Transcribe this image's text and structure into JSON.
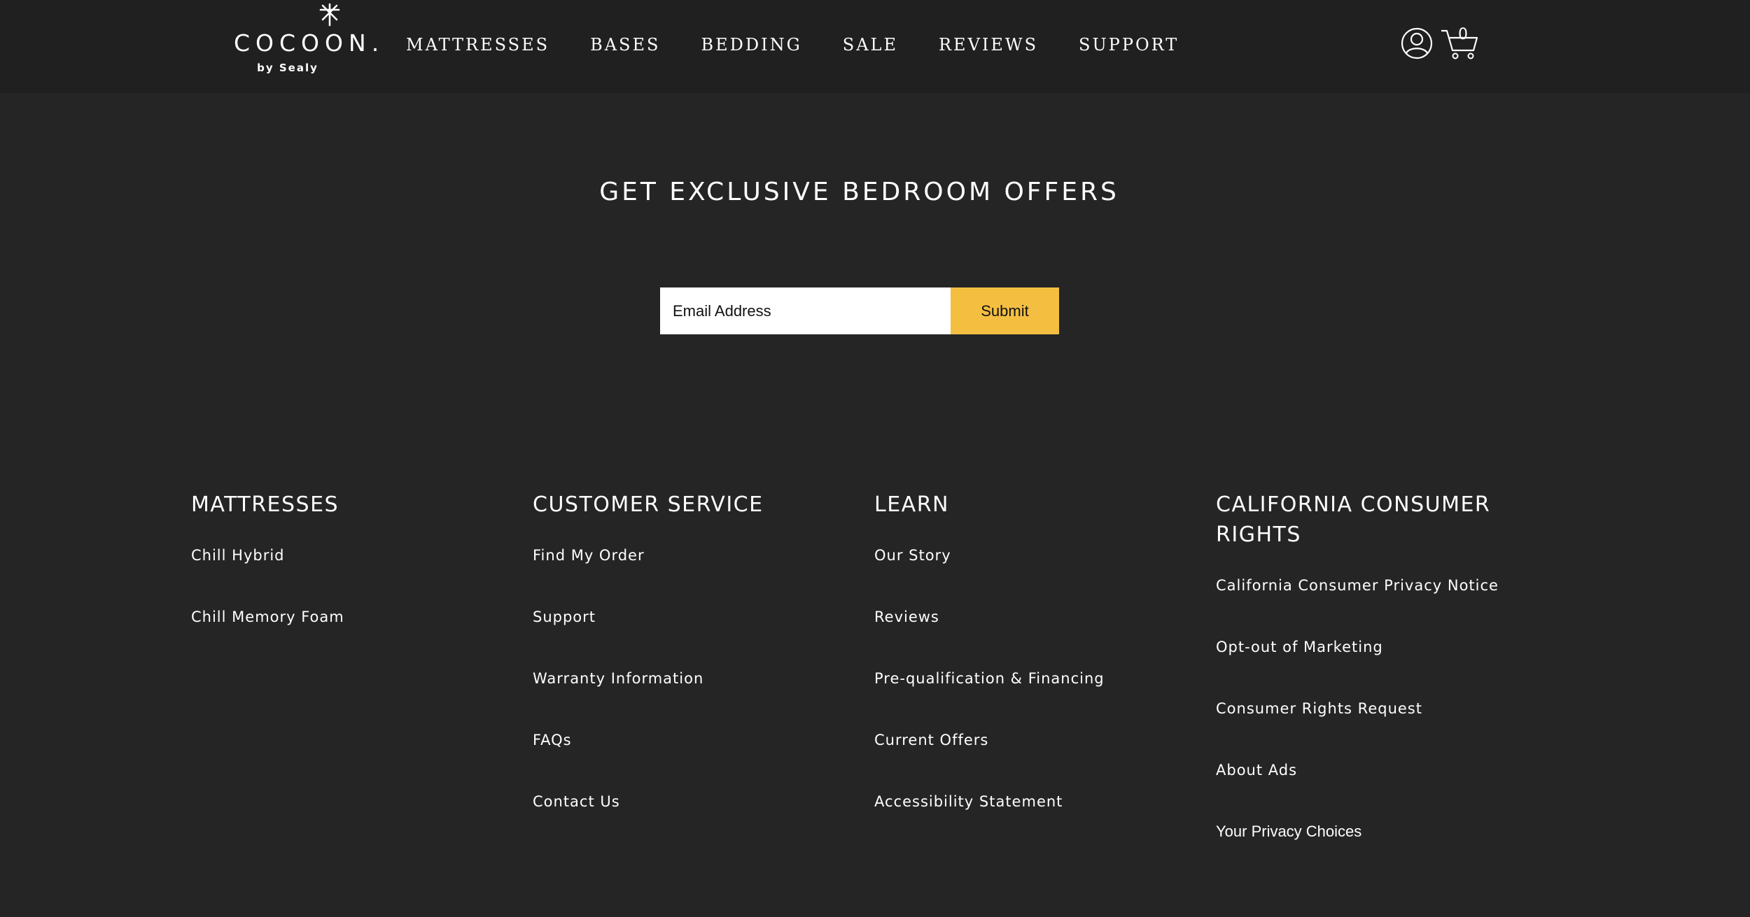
{
  "header": {
    "logo": {
      "wordmark": "COCOON.",
      "sub": "by Sealy"
    },
    "nav": [
      {
        "label": "MATTRESSES"
      },
      {
        "label": "BASES"
      },
      {
        "label": "BEDDING"
      },
      {
        "label": "SALE"
      },
      {
        "label": "REVIEWS"
      },
      {
        "label": "SUPPORT"
      }
    ],
    "account_icon": "user-circle-icon",
    "cart_icon": "cart-icon",
    "cart_count": "0"
  },
  "newsletter": {
    "title": "GET EXCLUSIVE BEDROOM OFFERS",
    "email_placeholder": "Email Address",
    "email_value": "",
    "submit_label": "Submit"
  },
  "footer": {
    "columns": [
      {
        "heading": "MATTRESSES",
        "links": [
          "Chill Hybrid",
          "Chill Memory Foam"
        ]
      },
      {
        "heading": "CUSTOMER SERVICE",
        "links": [
          "Find My Order",
          "Support",
          "Warranty Information",
          "FAQs",
          "Contact Us"
        ]
      },
      {
        "heading": "LEARN",
        "links": [
          "Our Story",
          "Reviews",
          "Pre-qualification & Financing",
          "Current Offers",
          "Accessibility Statement"
        ]
      },
      {
        "heading_line1": "CALIFORNIA CONSUMER",
        "heading_line2": "RIGHTS",
        "links": [
          "California Consumer Privacy Notice",
          "Opt-out of Marketing",
          "Consumer Rights Request",
          "About Ads",
          "Your Privacy Choices"
        ]
      }
    ]
  },
  "colors": {
    "header_bg": "#202020",
    "page_bg": "#252525",
    "accent": "#f4bf41",
    "text": "#ffffff"
  }
}
